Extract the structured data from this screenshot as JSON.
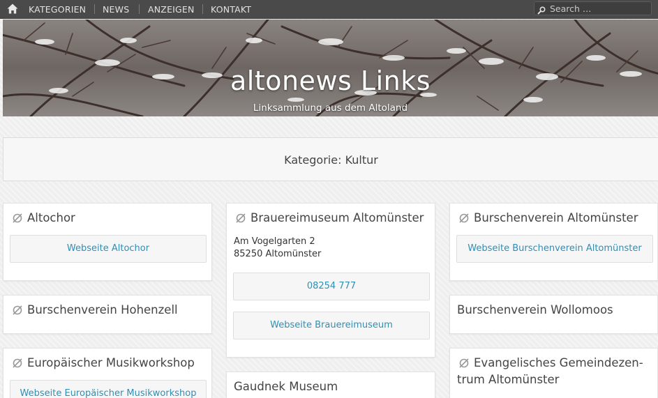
{
  "nav": {
    "home_icon": "home-icon",
    "items": [
      "KATEGORIEN",
      "NEWS",
      "ANZEIGEN",
      "KONTAKT"
    ],
    "search_placeholder": "Search …"
  },
  "header": {
    "title": "altonews Links",
    "tagline": "Linksammlung aus dem Altoland"
  },
  "category": {
    "title": "Kategorie: Kultur"
  },
  "cards": {
    "altochor": {
      "title": "Altochor",
      "link": "Webseite Altochor"
    },
    "brauereimuseum": {
      "title": "Brauereimuseum Altomünster",
      "address_line1": "Am Vogelgarten 2",
      "address_line2": "85250 Altomünster",
      "phone": "08254 777",
      "link": "Webseite Brauereimuseum"
    },
    "burschenverein_altomuenster": {
      "title": "Burschenverein Altomünster",
      "link": "Webseite Burschenverein Altomünster"
    },
    "burschenverein_hohenzell": {
      "title": "Burschenverein Hohenzell"
    },
    "burschenverein_wollomoos": {
      "title": "Burschenverein Wollomoos"
    },
    "musikworkshop": {
      "title": "Europäischer Musikworkshop",
      "link": "Webseite Europäischer Musikworkshop"
    },
    "gaudnek": {
      "title": "Gaudnek Museum"
    },
    "gemeindezentrum": {
      "title_line1": "Evangelisches Gemeindezen-",
      "title_line2": "trum Altomünster"
    }
  },
  "colors": {
    "nav_bg": "#4a4a4a",
    "link": "#2f8fb4",
    "page_bg": "#efefef"
  }
}
